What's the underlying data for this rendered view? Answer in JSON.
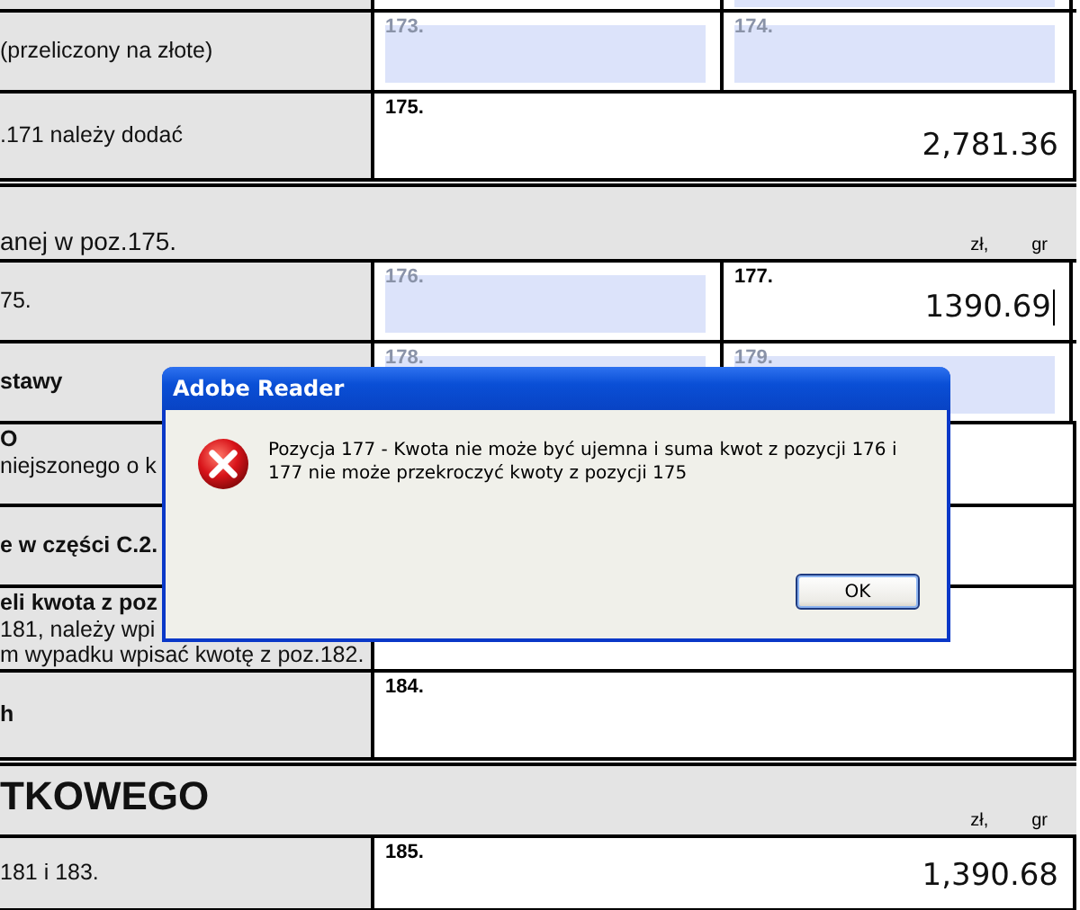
{
  "form_rows": [
    {
      "kind": "pair",
      "label_lines": [],
      "fields": [
        {
          "highlighted": false
        },
        {
          "highlighted": true
        }
      ]
    },
    {
      "kind": "pair",
      "label_lines": [
        {
          "text": "(przeliczony na złote)",
          "bold": false
        }
      ],
      "fields": [
        {
          "number": "173.",
          "highlighted": true
        },
        {
          "number": "174.",
          "highlighted": true
        }
      ]
    },
    {
      "kind": "single",
      "label_lines": [
        {
          "text": ".171 należy dodać",
          "bold": false
        }
      ],
      "fields": [
        {
          "number": "175.",
          "value": "2,781.36",
          "highlighted": false
        }
      ]
    },
    {
      "kind": "header",
      "text": "anej w poz.175.",
      "large": false,
      "units": [
        "zł,",
        "gr"
      ]
    },
    {
      "kind": "pair",
      "label_lines": [
        {
          "text": "75.",
          "bold": false
        }
      ],
      "fields": [
        {
          "number": "176.",
          "highlighted": true
        },
        {
          "number": "177.",
          "value": "1390.69",
          "highlighted": false,
          "cursor": true
        }
      ]
    },
    {
      "kind": "pair",
      "label_lines": [
        {
          "text": "stawy",
          "bold": true
        }
      ],
      "fields": [
        {
          "number": "178.",
          "highlighted": true
        },
        {
          "number": "179.",
          "highlighted": true
        }
      ]
    },
    {
      "kind": "single",
      "label_lines": [
        {
          "text": "O",
          "bold": true
        },
        {
          "text": "niejszonego o k",
          "bold": false
        }
      ],
      "fields": [
        {
          "highlighted": false
        }
      ]
    },
    {
      "kind": "single",
      "label_lines": [
        {
          "text": "e w części C.2.",
          "bold": true
        }
      ],
      "fields": [
        {
          "highlighted": false
        }
      ]
    },
    {
      "kind": "single",
      "label_lines": [
        {
          "text": "eli kwota z poz",
          "bold": true
        },
        {
          "text": "181, należy wpi",
          "bold": false
        },
        {
          "text": "m wypadku wpisać kwotę z poz.182.",
          "bold": false
        }
      ],
      "fields": [
        {
          "highlighted": false
        }
      ]
    },
    {
      "kind": "single",
      "label_lines": [
        {
          "text": "h",
          "bold": true
        }
      ],
      "fields": [
        {
          "number": "184.",
          "highlighted": false
        }
      ]
    },
    {
      "kind": "header",
      "text": "TKOWEGO",
      "large": true,
      "units": [
        "zł,",
        "gr"
      ]
    },
    {
      "kind": "single",
      "label_lines": [
        {
          "text": "181 i 183.",
          "bold": false
        }
      ],
      "fields": [
        {
          "number": "185.",
          "value": "1,390.68",
          "highlighted": false
        }
      ]
    }
  ],
  "dialog": {
    "title": "Adobe Reader",
    "message": "Pozycja 177 - Kwota nie może być ujemna i suma kwot z pozycji 176 i 177 nie może przekroczyć kwoty z pozycji 175",
    "buttons": [
      "OK"
    ]
  }
}
